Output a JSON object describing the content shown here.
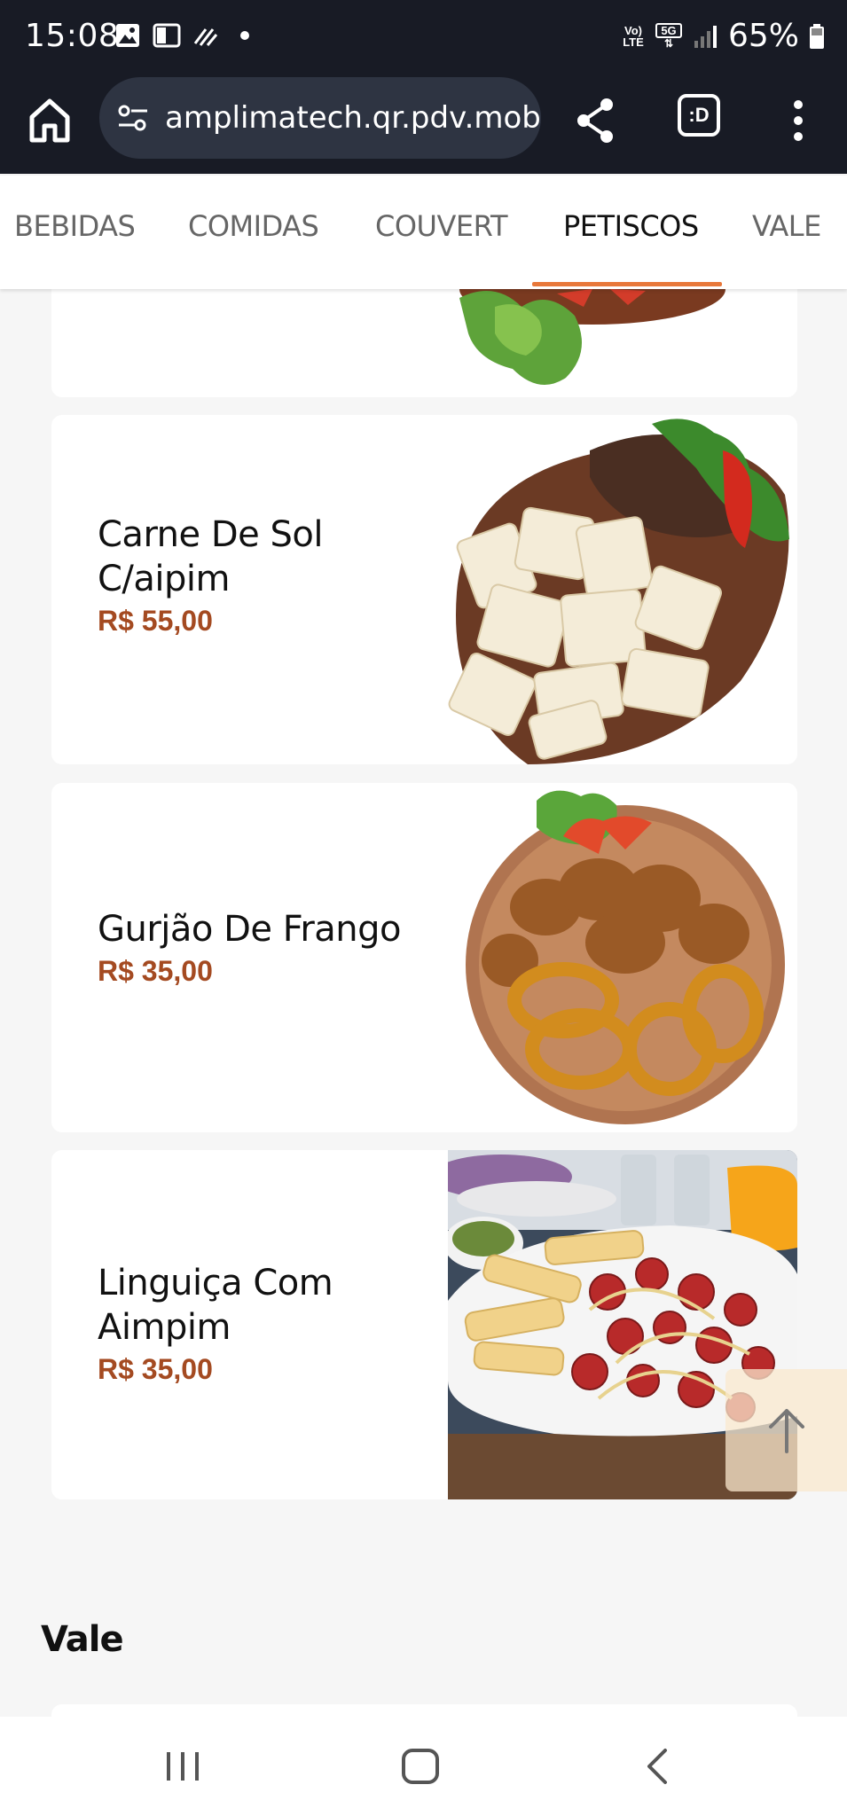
{
  "status_bar": {
    "time": "15:08",
    "battery": "65%",
    "volte_label": "Vo) LTE",
    "network_label": "5G"
  },
  "browser": {
    "url": "amplimatech.qr.pdv.mobi/c",
    "tab_switcher_label": ":D"
  },
  "tabs": [
    {
      "label": "BEBIDAS",
      "active": false
    },
    {
      "label": "COMIDAS",
      "active": false
    },
    {
      "label": "COUVERT",
      "active": false
    },
    {
      "label": "PETISCOS",
      "active": true
    },
    {
      "label": "VALE",
      "active": false
    }
  ],
  "accent_color": "#e8783a",
  "price_color": "#a44a21",
  "products": [
    {
      "name_line1": "Carne De Sol",
      "name_line2": "C/aipim",
      "price": "R$ 55,00"
    },
    {
      "name_line1": "Gurjão De Frango",
      "name_line2": "",
      "price": "R$ 35,00"
    },
    {
      "name_line1": "Linguiça Com",
      "name_line2": "Aimpim",
      "price": "R$ 35,00"
    }
  ],
  "next_section": {
    "title": "Vale"
  },
  "icons": {
    "home": "home-icon",
    "share": "share-icon",
    "menu": "more-vert-icon",
    "scroll_top": "arrow-up-icon"
  }
}
